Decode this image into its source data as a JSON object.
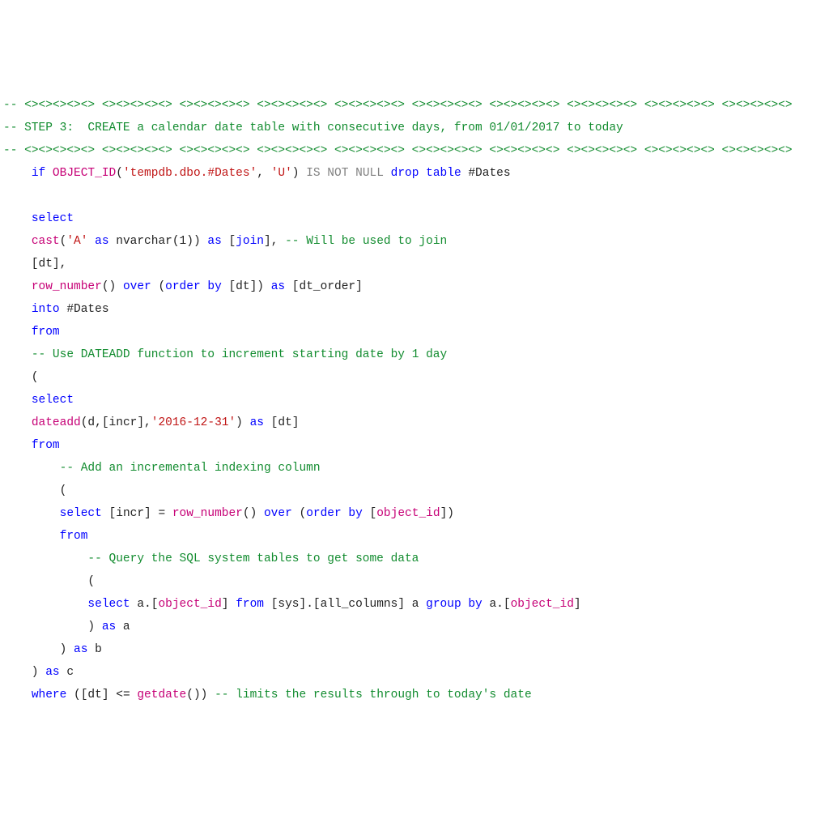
{
  "l1": {
    "a": "-- <><><><><> <><><><><> <><><><><> <><><><><> <><><><><> <><><><><> <><><><><> <><><><><> <><><><><> <><><><><>"
  },
  "l2": {
    "a": "-- STEP 3:  CREATE a calendar date table with consecutive days, from 01/01/2017 to today"
  },
  "l3": {
    "a": "-- <><><><><> <><><><><> <><><><><> <><><><><> <><><><><> <><><><><> <><><><><> <><><><><> <><><><><> <><><><><>"
  },
  "l4": {
    "a": "    ",
    "b": "if",
    "c": " ",
    "d": "OBJECT_ID",
    "e": "(",
    "f": "'tempdb.dbo.#Dates'",
    "g": ", ",
    "h": "'U'",
    "i": ") ",
    "j": "IS NOT NULL",
    "k": " ",
    "l": "drop",
    "m": " ",
    "n": "table",
    "o": " #Dates"
  },
  "l5": {
    "a": " "
  },
  "l6": {
    "a": "    ",
    "b": "select"
  },
  "l7": {
    "a": "    ",
    "b": "cast",
    "c": "(",
    "d": "'A'",
    "e": " ",
    "f": "as",
    "g": " nvarchar(1)) ",
    "h": "as",
    "i": " [",
    "j": "join",
    "k": "], ",
    "l": "-- Will be used to join"
  },
  "l8": {
    "a": "    [dt],"
  },
  "l9": {
    "a": "    ",
    "b": "row_number",
    "c": "() ",
    "d": "over",
    "e": " (",
    "f": "order",
    "g": " ",
    "h": "by",
    "i": " [dt]) ",
    "j": "as",
    "k": " [dt_order]"
  },
  "l10": {
    "a": "    ",
    "b": "into",
    "c": " #Dates"
  },
  "l11": {
    "a": "    ",
    "b": "from"
  },
  "l12": {
    "a": "    ",
    "b": "-- Use DATEADD function to increment starting date by 1 day"
  },
  "l13": {
    "a": "    ("
  },
  "l14": {
    "a": "    ",
    "b": "select"
  },
  "l15": {
    "a": "    ",
    "b": "dateadd",
    "c": "(d,[incr],",
    "d": "'2016-12-31'",
    "e": ") ",
    "f": "as",
    "g": " [dt]"
  },
  "l16": {
    "a": "    ",
    "b": "from"
  },
  "l17": {
    "a": "        ",
    "b": "-- Add an incremental indexing column"
  },
  "l18": {
    "a": "        ("
  },
  "l19": {
    "a": "        ",
    "b": "select",
    "c": " [incr] = ",
    "d": "row_number",
    "e": "() ",
    "f": "over",
    "g": " (",
    "h": "order",
    "i": " ",
    "j": "by",
    "k": " [",
    "l": "object_id",
    "m": "])"
  },
  "l20": {
    "a": "        ",
    "b": "from"
  },
  "l21": {
    "a": "            ",
    "b": "-- Query the SQL system tables to get some data"
  },
  "l22": {
    "a": "            ("
  },
  "l23": {
    "a": "            ",
    "b": "select",
    "c": " a.[",
    "d": "object_id",
    "e": "] ",
    "f": "from",
    "g": " [sys].[all_columns] a ",
    "h": "group",
    "i": " ",
    "j": "by",
    "k": " a.[",
    "l": "object_id",
    "m": "]"
  },
  "l24": {
    "a": "            ) ",
    "b": "as",
    "c": " a"
  },
  "l25": {
    "a": "        ) ",
    "b": "as",
    "c": " b"
  },
  "l26": {
    "a": "    ) ",
    "b": "as",
    "c": " c"
  },
  "l27": {
    "a": "    ",
    "b": "where",
    "c": " ([dt] <= ",
    "d": "getdate",
    "e": "()) ",
    "f": "-- limits the results through to today's date"
  }
}
